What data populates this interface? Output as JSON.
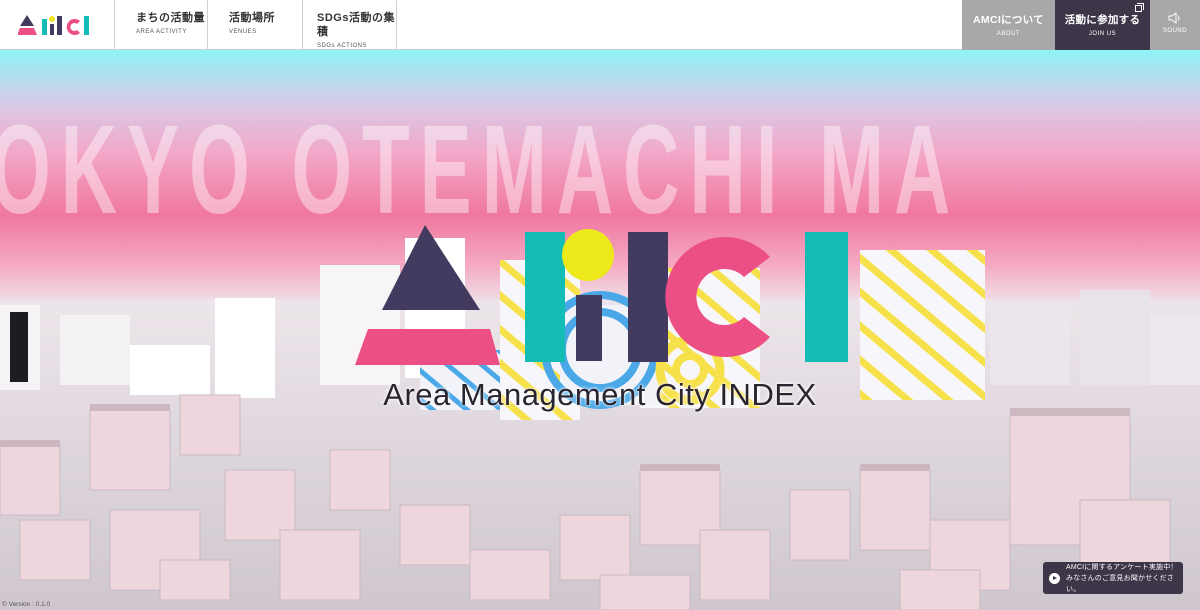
{
  "header": {
    "logo_alt": "AMCI",
    "nav": [
      {
        "jp": "まちの活動量",
        "en": "AREA ACTIVITY"
      },
      {
        "jp": "活動場所",
        "en": "VENUES"
      },
      {
        "jp": "SDGs活動の集積",
        "en": "SDGs ACTIONS"
      }
    ],
    "about": {
      "jp": "AMCIについて",
      "en": "ABOUT"
    },
    "join": {
      "jp": "活動に参加する",
      "en": "JOIN US"
    },
    "sound": {
      "en": "SOUND"
    }
  },
  "hero": {
    "background_text": "OKYO  OTEMACHI  MA",
    "logo_text": "AMCI",
    "subtitle": "Area Management City INDEX"
  },
  "footer": {
    "version": "© Version : 0.1.0",
    "survey_line1": "AMCIに関するアンケート実施中！",
    "survey_line2": "みなさんのご意見お聞かせください。"
  },
  "colors": {
    "navy": "#3d3548",
    "pink": "#ec4f86",
    "teal": "#13bdb6",
    "yellow": "#ece81a",
    "purple": "#433a60"
  }
}
